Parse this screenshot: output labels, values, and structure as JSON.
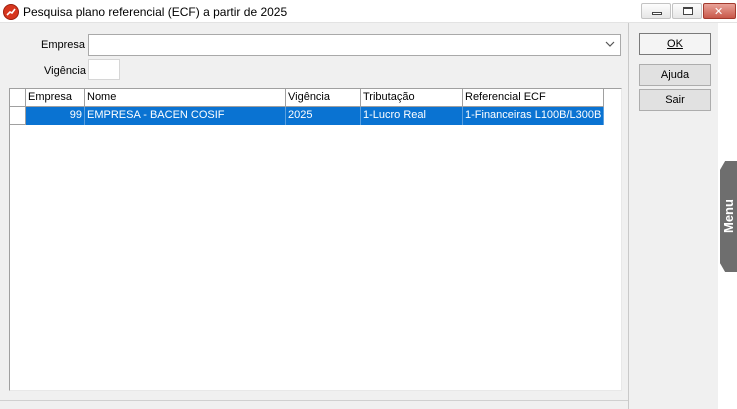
{
  "window": {
    "title": "Pesquisa plano referencial (ECF) a partir de 2025",
    "close_glyph": "✕"
  },
  "form": {
    "empresa_label": "Empresa",
    "empresa_value": "",
    "vigencia_label": "Vigência",
    "vigencia_value": ""
  },
  "grid": {
    "columns": [
      "Empresa",
      "Nome",
      "Vigência",
      "Tributação",
      "Referencial ECF"
    ],
    "rows": [
      {
        "empresa": "99",
        "nome": "EMPRESA - BACEN COSIF",
        "vigencia": "2025",
        "tributacao": "1-Lucro Real",
        "referencial": "1-Financeiras L100B/L300B",
        "selected": true
      }
    ]
  },
  "buttons": {
    "ok": "OK",
    "ajuda": "Ajuda",
    "sair": "Sair"
  },
  "side_tab": {
    "label": "Menu"
  },
  "colors": {
    "selection": "#0a73d2",
    "menu_tab": "#6e6e6e",
    "app_icon": "#d7361e"
  }
}
